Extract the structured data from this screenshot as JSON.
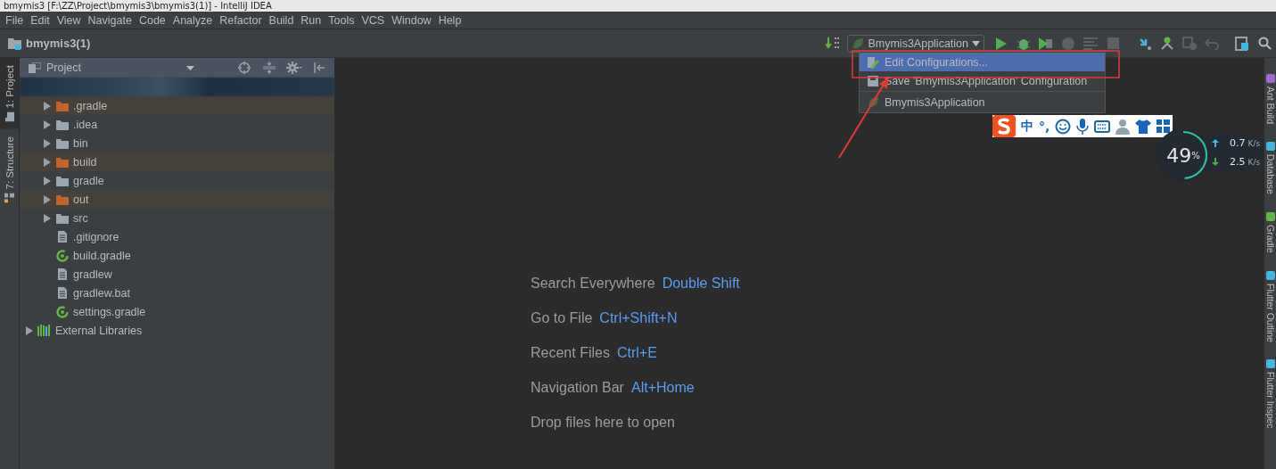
{
  "window": {
    "title": "bmymis3 [F:\\ZZ\\Project\\bmymis3\\bmymis3(1)] - IntelliJ IDEA"
  },
  "menu": [
    "File",
    "Edit",
    "View",
    "Navigate",
    "Code",
    "Analyze",
    "Refactor",
    "Build",
    "Run",
    "Tools",
    "VCS",
    "Window",
    "Help"
  ],
  "breadcrumb": {
    "label": "bmymis3(1)"
  },
  "run_config": {
    "label": "Bmymis3Application"
  },
  "config_menu": {
    "items": [
      {
        "label": "Edit Configurations...",
        "kind": "edit",
        "selected": true
      },
      {
        "label": "Save 'Bmymis3Application' Configuration",
        "kind": "save",
        "selected": false
      },
      {
        "label": "Bmymis3Application",
        "kind": "app",
        "selected": false
      }
    ]
  },
  "left_tabs": [
    {
      "label": "1: Project",
      "selected": true
    },
    {
      "label": "7: Structure",
      "selected": false
    }
  ],
  "project_panel": {
    "title": "Project",
    "tree": [
      {
        "kind": "blurred",
        "expanded": true,
        "children": [
          {
            "label": ".gradle",
            "kind": "folder",
            "excluded": true,
            "expanded": false
          },
          {
            "label": ".idea",
            "kind": "folder",
            "excluded": false,
            "expanded": false
          },
          {
            "label": "bin",
            "kind": "folder",
            "excluded": false,
            "expanded": false
          },
          {
            "label": "build",
            "kind": "folder",
            "excluded": true,
            "expanded": false
          },
          {
            "label": "gradle",
            "kind": "folder",
            "excluded": false,
            "expanded": false
          },
          {
            "label": "out",
            "kind": "folder",
            "excluded": true,
            "expanded": false
          },
          {
            "label": "src",
            "kind": "folder",
            "excluded": false,
            "expanded": false
          },
          {
            "label": ".gitignore",
            "kind": "file"
          },
          {
            "label": "build.gradle",
            "kind": "gradle"
          },
          {
            "label": "gradlew",
            "kind": "file"
          },
          {
            "label": "gradlew.bat",
            "kind": "file"
          },
          {
            "label": "settings.gradle",
            "kind": "gradle"
          }
        ]
      },
      {
        "label": "External Libraries",
        "kind": "library",
        "expanded": false
      }
    ]
  },
  "hints": [
    {
      "label": "Search Everywhere",
      "shortcut": "Double Shift"
    },
    {
      "label": "Go to File",
      "shortcut": "Ctrl+Shift+N"
    },
    {
      "label": "Recent Files",
      "shortcut": "Ctrl+E"
    },
    {
      "label": "Navigation Bar",
      "shortcut": "Alt+Home"
    },
    {
      "label": "Drop files here to open"
    }
  ],
  "ime_toolbar": {
    "items": [
      "中",
      "°,"
    ]
  },
  "net_widget": {
    "percent": "49",
    "unit": "%",
    "level": 0.49,
    "up": {
      "value": "0.7",
      "unit": "K/s"
    },
    "down": {
      "value": "2.5",
      "unit": "K/s"
    }
  },
  "right_tabs": [
    "Ant Build",
    "Database",
    "Gradle",
    "Flutter Outline",
    "Flutter Inspec"
  ]
}
